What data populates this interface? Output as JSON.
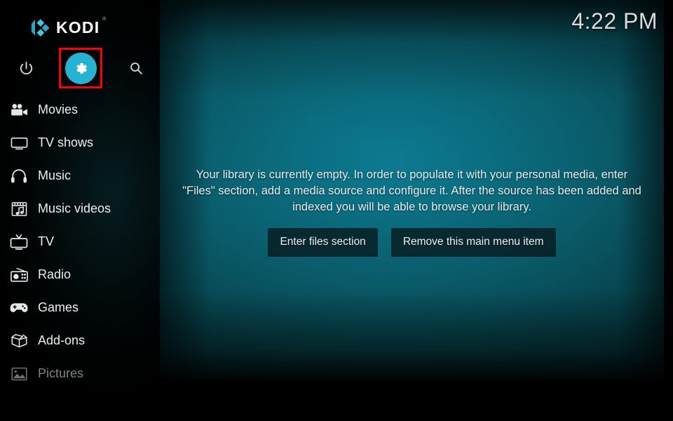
{
  "app": {
    "brand_name": "KODI",
    "brand_tm": "®",
    "accent_color": "#26b3d1",
    "highlight_color": "#fe0000"
  },
  "header": {
    "clock": "4:22 PM"
  },
  "toolbar": {
    "power_label": "Power",
    "settings_label": "Settings",
    "search_label": "Search",
    "icons": {
      "power": "power-icon",
      "settings": "gear-icon",
      "search": "search-icon"
    }
  },
  "sidebar": {
    "items": [
      {
        "label": "Movies",
        "icon": "movie-camera-icon",
        "dimmed": false
      },
      {
        "label": "TV shows",
        "icon": "television-icon",
        "dimmed": false
      },
      {
        "label": "Music",
        "icon": "headphones-icon",
        "dimmed": false
      },
      {
        "label": "Music videos",
        "icon": "film-note-icon",
        "dimmed": false
      },
      {
        "label": "TV",
        "icon": "tv-antenna-icon",
        "dimmed": false
      },
      {
        "label": "Radio",
        "icon": "radio-icon",
        "dimmed": false
      },
      {
        "label": "Games",
        "icon": "gamepad-icon",
        "dimmed": false
      },
      {
        "label": "Add-ons",
        "icon": "open-box-icon",
        "dimmed": false
      },
      {
        "label": "Pictures",
        "icon": "picture-icon",
        "dimmed": true
      }
    ]
  },
  "main": {
    "empty_message": "Your library is currently empty. In order to populate it with your personal media, enter \"Files\" section, add a media source and configure it. After the source has been added and indexed you will be able to browse your library.",
    "buttons": {
      "enter_files": "Enter files section",
      "remove_menu_item": "Remove this main menu item"
    }
  }
}
